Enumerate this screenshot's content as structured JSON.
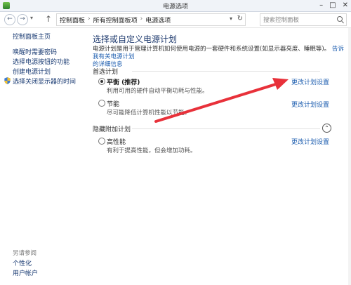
{
  "window": {
    "title": "电源选项"
  },
  "address": {
    "crumbs": [
      "控制面板",
      "所有控制面板项",
      "电源选项"
    ]
  },
  "search": {
    "placeholder": "搜索控制面板"
  },
  "sidebar": {
    "home": "控制面板主页",
    "items": [
      "唤醒时需要密码",
      "选择电源按钮的功能",
      "创建电源计划",
      "选择关闭显示器的时间"
    ],
    "see_also_title": "另请参阅",
    "see_also": [
      "个性化",
      "用户帐户"
    ]
  },
  "main": {
    "heading": "选择或自定义电源计划",
    "desc_line1": "电源计划是用于管理计算机如何使用电源的一套硬件和系统设置(如显示器亮度、睡眠等)。",
    "desc_link1": "告诉我有关电源计划",
    "desc_link2": "的详细信息",
    "preferred_label": "首选计划",
    "hidden_label": "隐藏附加计划",
    "change_link": "更改计划设置",
    "plans": [
      {
        "name": "平衡 (推荐)",
        "desc": "利用可用的硬件自动平衡功耗与性能。",
        "selected": true
      },
      {
        "name": "节能",
        "desc": "尽可能降低计算机性能以节能。",
        "selected": false
      },
      {
        "name": "高性能",
        "desc": "有利于提高性能，但会增加功耗。",
        "selected": false
      }
    ]
  },
  "colors": {
    "link": "#1f5fb0",
    "heading": "#1e3a6e",
    "arrow": "#e8313a"
  }
}
